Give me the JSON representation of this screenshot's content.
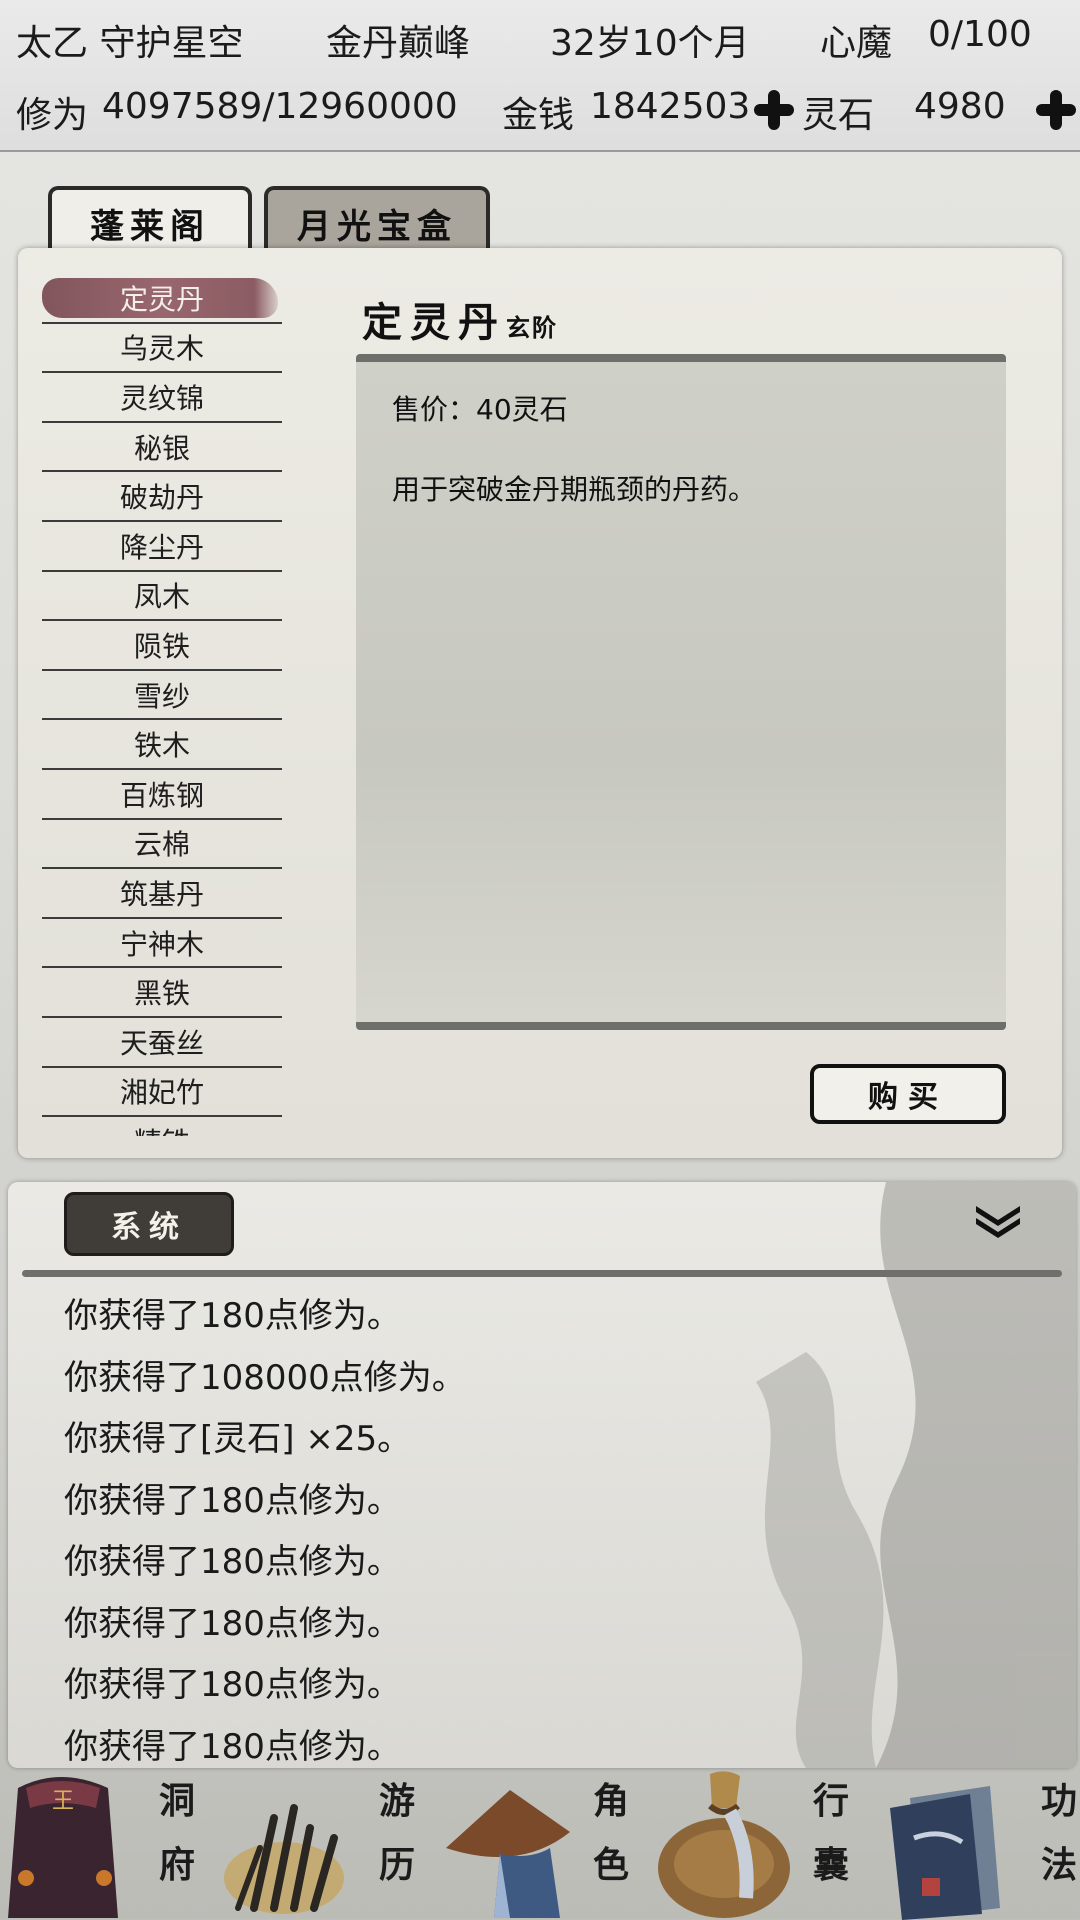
{
  "status": {
    "player_name": "太乙 守护星空",
    "realm": "金丹巅峰",
    "age": "32岁10个月",
    "heart_demon_label": "心魔",
    "heart_demon_value": "0/100",
    "cultivation_label": "修为",
    "cultivation_value": "4097589/12960000",
    "money_label": "金钱",
    "money_value": "1842503",
    "spirit_stone_label": "灵石",
    "spirit_stone_value": "4980"
  },
  "tabs": [
    {
      "label": "蓬莱阁",
      "active": true
    },
    {
      "label": "月光宝盒",
      "active": false
    }
  ],
  "shop": {
    "items": [
      "定灵丹",
      "乌灵木",
      "灵纹锦",
      "秘银",
      "破劫丹",
      "降尘丹",
      "凤木",
      "陨铁",
      "雪纱",
      "铁木",
      "百炼钢",
      "云棉",
      "筑基丹",
      "宁神木",
      "黑铁",
      "天蚕丝",
      "湘妃竹",
      "精铁"
    ],
    "selected_index": 0,
    "detail": {
      "name": "定灵丹",
      "grade": "玄阶",
      "price": "售价：40灵石",
      "description": "用于突破金丹期瓶颈的丹药。"
    },
    "buy_label": "购买"
  },
  "log": {
    "tab_label": "系统",
    "lines": [
      "你获得了180点修为。",
      "你获得了108000点修为。",
      "你获得了[灵石] ×25。",
      "你获得了180点修为。",
      "你获得了180点修为。",
      "你获得了180点修为。",
      "你获得了180点修为。",
      "你获得了180点修为。"
    ]
  },
  "nav": [
    {
      "label_top": "洞",
      "label_bottom": "府",
      "icon": "cave-dwelling-icon"
    },
    {
      "label_top": "游",
      "label_bottom": "历",
      "icon": "travel-icon"
    },
    {
      "label_top": "角",
      "label_bottom": "色",
      "icon": "character-icon"
    },
    {
      "label_top": "行",
      "label_bottom": "囊",
      "icon": "bag-icon"
    },
    {
      "label_top": "功",
      "label_bottom": "法",
      "icon": "technique-book-icon"
    }
  ]
}
